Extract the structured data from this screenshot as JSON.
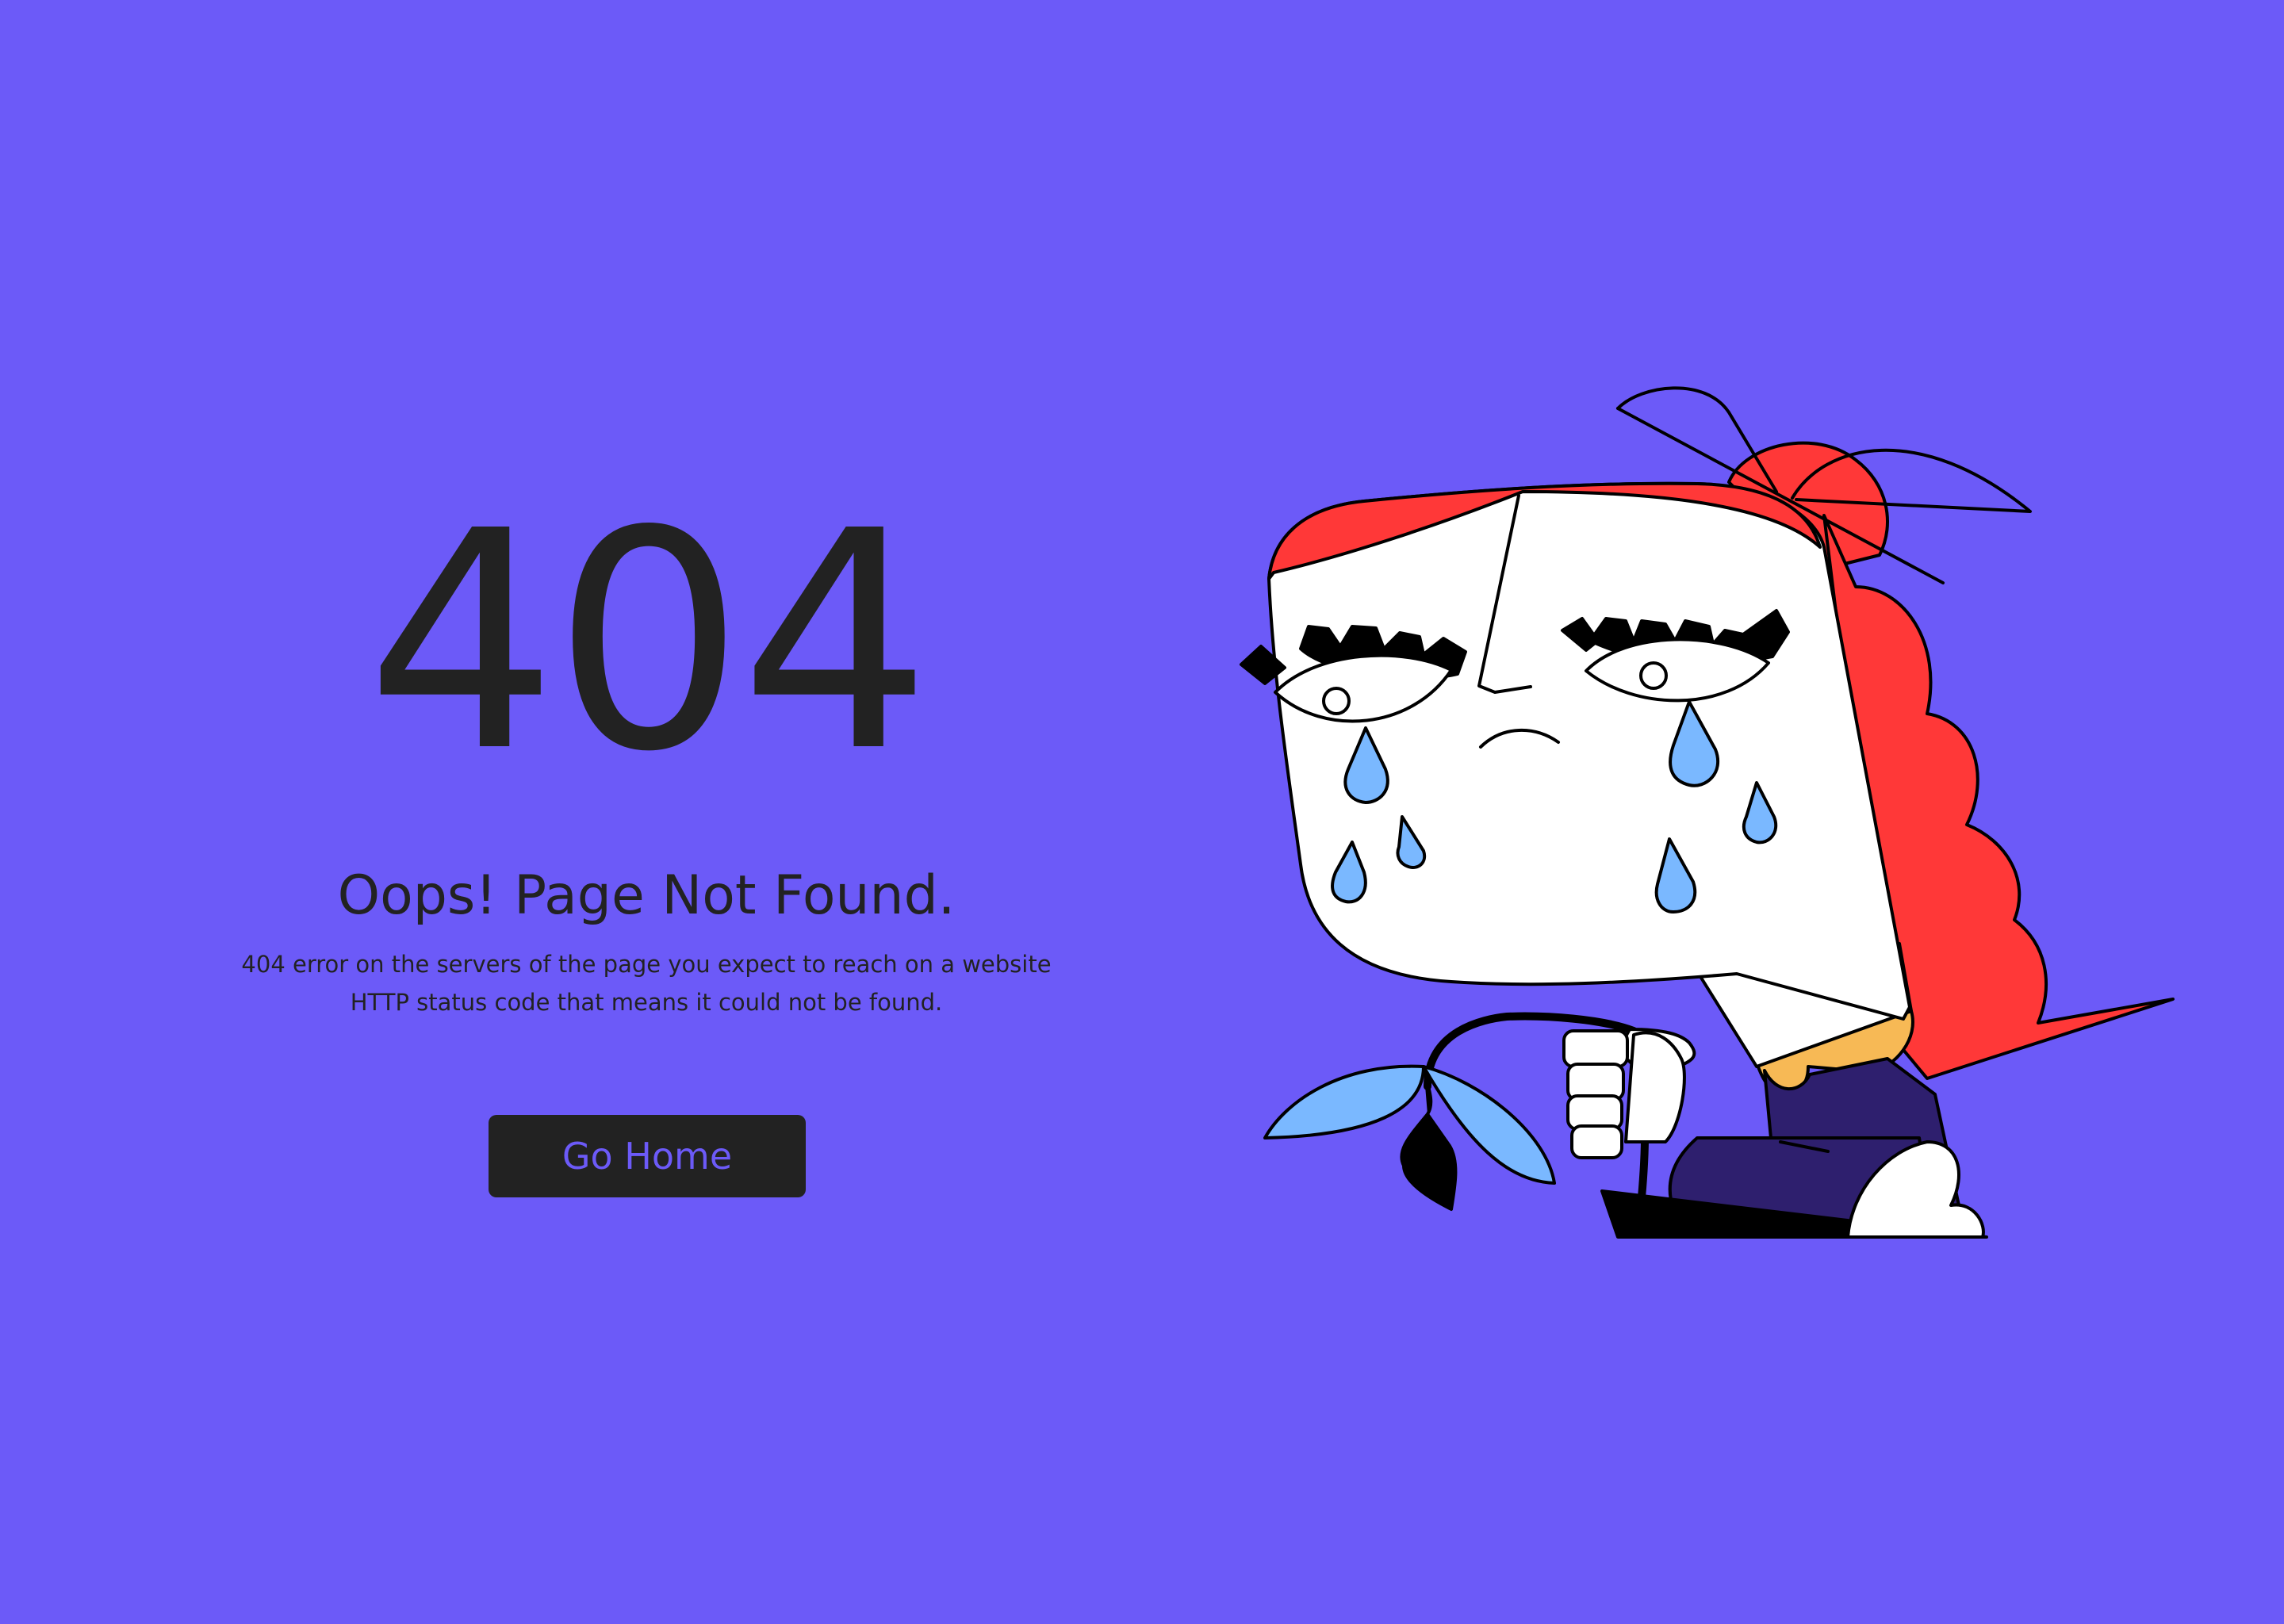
{
  "error": {
    "code": "404",
    "headline": "Oops! Page Not Found.",
    "description_lines": [
      "404 error on the servers of the page you expect to reach on a website",
      "HTTP status code that means it could not be found."
    ]
  },
  "actions": {
    "go_home_label": "Go Home"
  },
  "illustration": {
    "subject": "crying-girl-holding-wilted-flower"
  },
  "colors": {
    "background": "#6c5af8",
    "text": "#222222",
    "button_bg": "#222222",
    "button_text": "#6c5af8",
    "hair": "#ff3838",
    "tear": "#7ab8ff",
    "shirt": "#2e1f6e",
    "collar": "#f7b955",
    "flower": "#7ab8ff"
  }
}
